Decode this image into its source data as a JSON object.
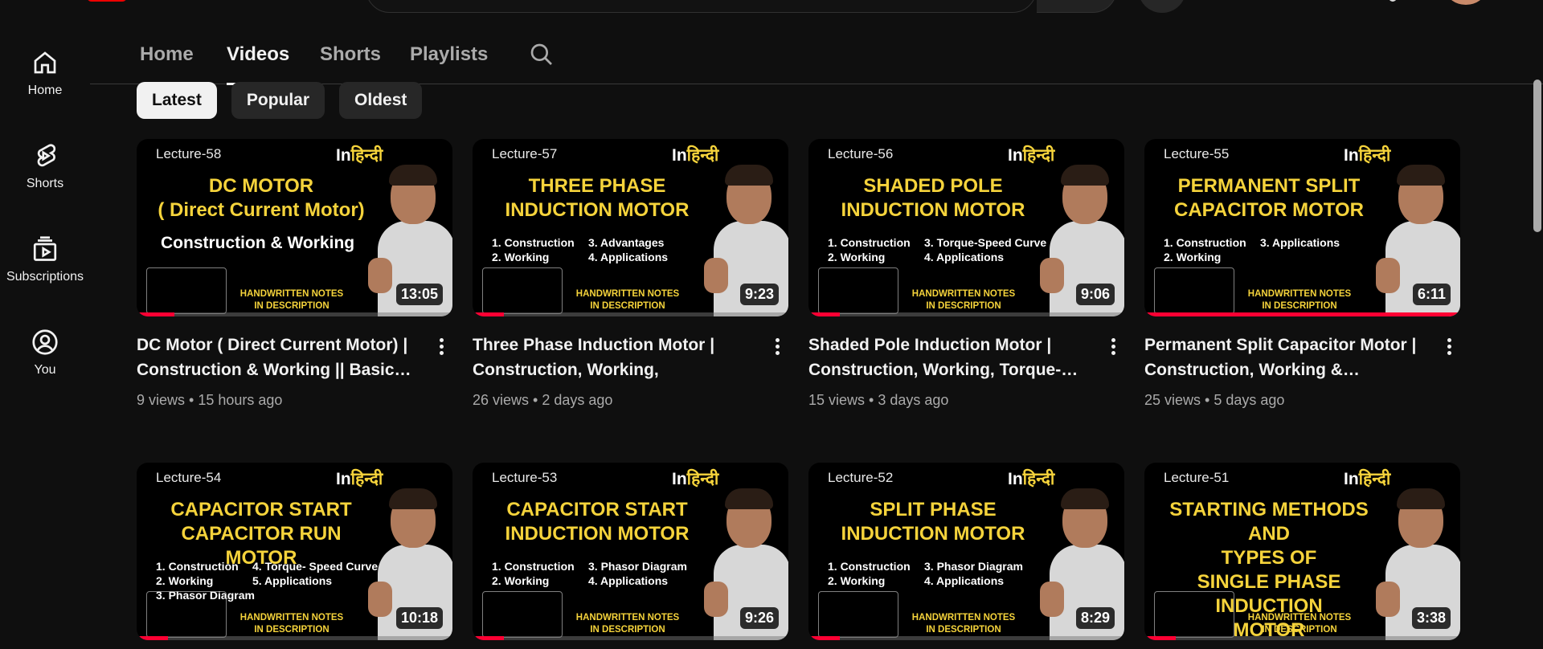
{
  "colors": {
    "background": "#0f0f0f",
    "accent_yellow": "#f5d33b",
    "progress_red": "#ff0033",
    "muted_text": "#aaaaaa"
  },
  "sidebar": {
    "items": [
      {
        "label": "Home",
        "icon": "home-icon"
      },
      {
        "label": "Shorts",
        "icon": "shorts-icon"
      },
      {
        "label": "Subscriptions",
        "icon": "subscriptions-icon"
      },
      {
        "label": "You",
        "icon": "you-icon"
      }
    ]
  },
  "tabs": [
    {
      "label": "Home",
      "active": false
    },
    {
      "label": "Videos",
      "active": true
    },
    {
      "label": "Shorts",
      "active": false
    },
    {
      "label": "Playlists",
      "active": false
    }
  ],
  "chips": [
    {
      "label": "Latest",
      "active": true
    },
    {
      "label": "Popular",
      "active": false
    },
    {
      "label": "Oldest",
      "active": false
    }
  ],
  "videos": [
    {
      "thumb": {
        "lecture": "Lecture-58",
        "lang_prefix": "In",
        "lang": "हिन्दी",
        "title": "DC MOTOR\n( Direct Current Motor)",
        "subtitle": "Construction & Working",
        "points_left": "",
        "points_right": "",
        "notes": "HANDWRITTEN NOTES\nIN DESCRIPTION"
      },
      "duration": "13:05",
      "progress": 0.12,
      "title": "DC Motor ( Direct Current Motor) | Construction & Working || Basic…",
      "views": "9 views",
      "age": "15 hours ago"
    },
    {
      "thumb": {
        "lecture": "Lecture-57",
        "lang_prefix": "In",
        "lang": "हिन्दी",
        "title": "THREE PHASE\nINDUCTION MOTOR",
        "subtitle": "",
        "points_left": "1. Construction\n2. Working",
        "points_right": "3. Advantages\n4. Applications",
        "notes": "HANDWRITTEN NOTES\nIN DESCRIPTION"
      },
      "duration": "9:23",
      "progress": 0.1,
      "title": "Three Phase Induction Motor | Construction, Working, Advantage…",
      "views": "26 views",
      "age": "2 days ago"
    },
    {
      "thumb": {
        "lecture": "Lecture-56",
        "lang_prefix": "In",
        "lang": "हिन्दी",
        "title": "SHADED  POLE\nINDUCTION MOTOR",
        "subtitle": "",
        "points_left": "1. Construction\n2. Working",
        "points_right": "3. Torque-Speed Curve\n4. Applications",
        "notes": "HANDWRITTEN NOTES\nIN DESCRIPTION"
      },
      "duration": "9:06",
      "progress": 0.1,
      "title": "Shaded Pole Induction Motor | Construction, Working, Torque-…",
      "views": "15 views",
      "age": "3 days ago"
    },
    {
      "thumb": {
        "lecture": "Lecture-55",
        "lang_prefix": "In",
        "lang": "हिन्दी",
        "title": "PERMANENT SPLIT\nCAPACITOR MOTOR",
        "subtitle": "",
        "points_left": "1. Construction\n2. Working",
        "points_right": "3. Applications",
        "notes": "HANDWRITTEN NOTES\nIN DESCRIPTION"
      },
      "duration": "6:11",
      "progress": 1.0,
      "title": "Permanent Split Capacitor Motor | Construction, Working &…",
      "views": "25 views",
      "age": "5 days ago"
    },
    {
      "thumb": {
        "lecture": "Lecture-54",
        "lang_prefix": "In",
        "lang": "हिन्दी",
        "title": "CAPACITOR START\nCAPACITOR RUN MOTOR",
        "subtitle": "",
        "points_left": "1. Construction\n2. Working\n3. Phasor Diagram",
        "points_right": "4. Torque- Speed Curve\n5. Applications",
        "notes": "HANDWRITTEN NOTES\nIN DESCRIPTION"
      },
      "duration": "10:18",
      "progress": 0.1,
      "title": "",
      "views": "",
      "age": ""
    },
    {
      "thumb": {
        "lecture": "Lecture-53",
        "lang_prefix": "In",
        "lang": "हिन्दी",
        "title": "CAPACITOR START\nINDUCTION MOTOR",
        "subtitle": "",
        "points_left": "1. Construction\n2. Working",
        "points_right": "3. Phasor Diagram\n4. Applications",
        "notes": "HANDWRITTEN NOTES\nIN DESCRIPTION"
      },
      "duration": "9:26",
      "progress": 0.1,
      "title": "",
      "views": "",
      "age": ""
    },
    {
      "thumb": {
        "lecture": "Lecture-52",
        "lang_prefix": "In",
        "lang": "हिन्दी",
        "title": "SPLIT PHASE\nINDUCTION MOTOR",
        "subtitle": "",
        "points_left": "1. Construction\n2. Working",
        "points_right": "3. Phasor Diagram\n4. Applications",
        "notes": "HANDWRITTEN NOTES\nIN DESCRIPTION"
      },
      "duration": "8:29",
      "progress": 0.1,
      "title": "",
      "views": "",
      "age": ""
    },
    {
      "thumb": {
        "lecture": "Lecture-51",
        "lang_prefix": "In",
        "lang": "हिन्दी",
        "title": "STARTING METHODS AND\nTYPES OF\nSINGLE PHASE INDUCTION\nMOTOR",
        "subtitle": "",
        "points_left": "",
        "points_right": "",
        "notes": "HANDWRITTEN NOTES\nIN DESCRIPTION"
      },
      "duration": "3:38",
      "progress": 0.1,
      "title": "",
      "views": "",
      "age": ""
    }
  ]
}
